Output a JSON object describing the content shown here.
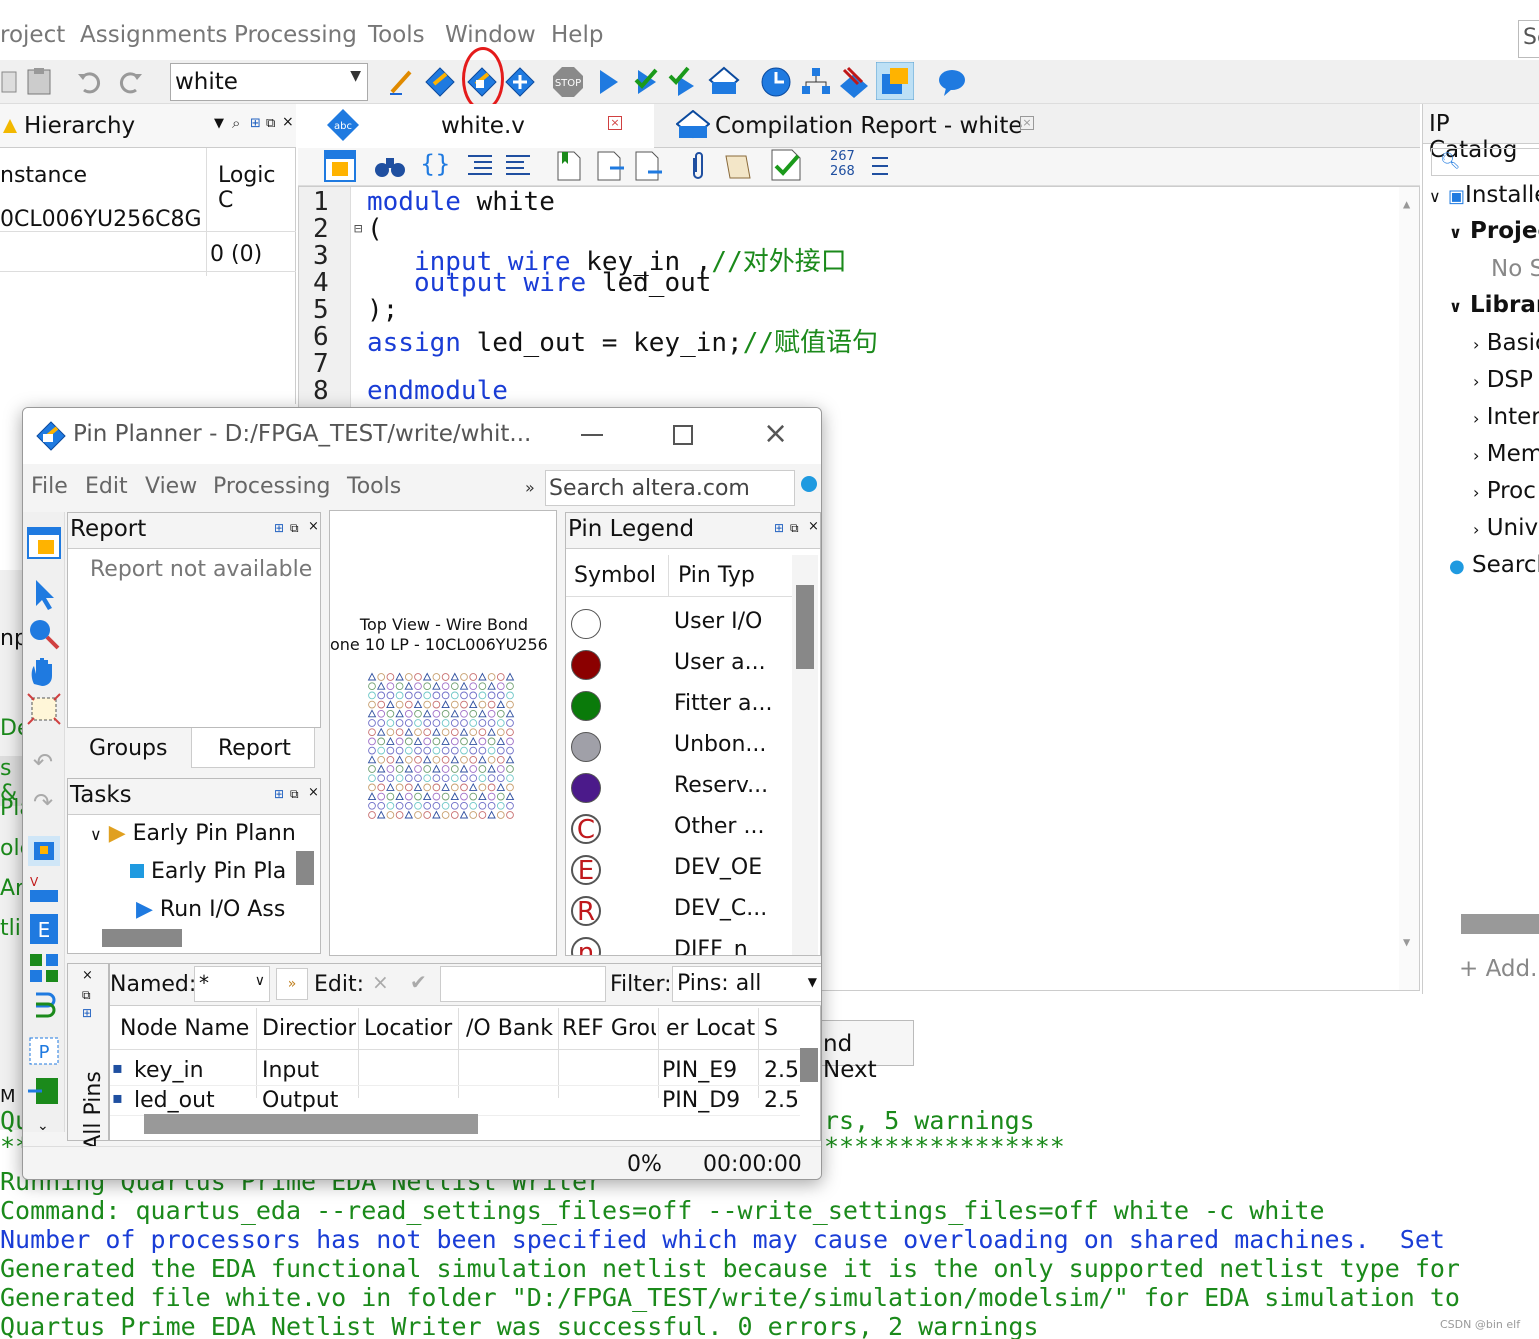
{
  "menubar": {
    "items": [
      "roject",
      "Assignments",
      "Processing",
      "Tools",
      "Window",
      "Help"
    ],
    "search_stub": "Se"
  },
  "toolbar": {
    "revision": "white",
    "icons": [
      "copy-icon",
      "paste-icon",
      "undo-icon",
      "redo-icon",
      "edit-icon",
      "analysis-icon",
      "pin-planner-icon",
      "chip-icon",
      "stop-icon",
      "play-icon",
      "check-icon",
      "check-play-icon",
      "assign-icon",
      "timing-icon",
      "netlist-icon",
      "rtl-icon",
      "chip-planner-icon",
      "help-icon"
    ]
  },
  "hierarchy": {
    "title": "Hierarchy",
    "col_instance": "nstance",
    "col_logic": "Logic C",
    "device": "0CL006YU256C8G",
    "logic_value": "0 (0)"
  },
  "editor": {
    "tab_file": "white.v",
    "tab_report": "Compilation Report - white",
    "linenums_top": "267",
    "linenums_bot": "268",
    "lines": [
      {
        "n": "1",
        "parts": [
          {
            "k": "kw",
            "t": "module"
          },
          {
            "k": "",
            "t": " white"
          }
        ]
      },
      {
        "n": "2",
        "parts": [
          {
            "k": "",
            "t": "("
          }
        ]
      },
      {
        "n": "3",
        "parts": [
          {
            "k": "",
            "t": "   "
          },
          {
            "k": "kw",
            "t": "input"
          },
          {
            "k": "",
            "t": " "
          },
          {
            "k": "kw",
            "t": "wire"
          },
          {
            "k": "",
            "t": " key_in ,"
          },
          {
            "k": "cm",
            "t": "//对外接口"
          }
        ]
      },
      {
        "n": "4",
        "parts": [
          {
            "k": "",
            "t": "   "
          },
          {
            "k": "kw",
            "t": "output"
          },
          {
            "k": "",
            "t": " "
          },
          {
            "k": "kw",
            "t": "wire"
          },
          {
            "k": "",
            "t": " led_out"
          }
        ]
      },
      {
        "n": "5",
        "parts": [
          {
            "k": "",
            "t": ");"
          }
        ]
      },
      {
        "n": "6",
        "parts": [
          {
            "k": "kw",
            "t": "assign"
          },
          {
            "k": "",
            "t": " led_out = key_in;"
          },
          {
            "k": "cm",
            "t": "//赋值语句"
          }
        ]
      },
      {
        "n": "7",
        "parts": []
      },
      {
        "n": "8",
        "parts": [
          {
            "k": "kw",
            "t": "endmodule"
          }
        ]
      }
    ]
  },
  "ip_catalog": {
    "title": "IP Catalog",
    "installed": "Installe",
    "project": "Projec",
    "no_sel": "No S",
    "library": "Librar",
    "items": [
      "Basic",
      "DSP",
      "Inter",
      "Mem",
      "Proc",
      "Univ"
    ],
    "search": "Search",
    "add": "+ Add..."
  },
  "find_next": "nd Next",
  "left_clips": [
    "np",
    "De",
    "s &",
    "Pla",
    "ole",
    "Ar",
    "tli",
    "M"
  ],
  "messages": {
    "m1a": "Qu",
    "m1b": "rs, 5 warnings",
    "m2a": "**",
    "m2b": "****************",
    "m3": "Running Quartus Prime EDA Netlist Writer",
    "m4": "Command: quartus_eda --read_settings_files=off --write_settings_files=off white -c white",
    "m5": "Number of processors has not been specified which may cause overloading on shared machines.  Set",
    "m6": "Generated the EDA functional simulation netlist because it is the only supported netlist type for",
    "m7": "Generated file white.vo in folder \"D:/FPGA_TEST/write/simulation/modelsim/\" for EDA simulation to",
    "m8": "Quartus Prime EDA Netlist Writer was successful. 0 errors, 2 warnings"
  },
  "pin_planner": {
    "title": "Pin Planner - D:/FPGA_TEST/write/whit...",
    "menu": [
      "File",
      "Edit",
      "View",
      "Processing",
      "Tools"
    ],
    "more": "»",
    "search_placeholder": "Search altera.com",
    "report_title": "Report",
    "report_msg": "Report not available",
    "tab_groups": "Groups",
    "tab_report": "Report",
    "tasks_title": "Tasks",
    "tasks": [
      "Early Pin Plann",
      "Early Pin Pla",
      "Run I/O Ass"
    ],
    "package_line1": "Top View - Wire Bond",
    "package_line2": "one 10 LP - 10CL006YU256",
    "legend_title": "Pin Legend",
    "legend_col1": "Symbol",
    "legend_col2": "Pin Typ",
    "legend": [
      {
        "label": "User I/O",
        "color": "#ffffff",
        "letter": ""
      },
      {
        "label": "User a...",
        "color": "#8b0000",
        "letter": ""
      },
      {
        "label": "Fitter a...",
        "color": "#0a7a0a",
        "letter": ""
      },
      {
        "label": "Unbon...",
        "color": "#a0a0a8",
        "letter": ""
      },
      {
        "label": "Reserv...",
        "color": "#4b1a8a",
        "letter": ""
      },
      {
        "label": "Other ...",
        "color": "#ffffff",
        "letter": "C"
      },
      {
        "label": "DEV_OE",
        "color": "#ffffff",
        "letter": "E"
      },
      {
        "label": "DEV_C...",
        "color": "#ffffff",
        "letter": "R"
      },
      {
        "label": "DIFF_n",
        "color": "#ffffff",
        "letter": "n"
      }
    ],
    "named_label": "Named:",
    "named_value": "*",
    "edit_label": "Edit:",
    "filter_label": "Filter:",
    "filter_value": "Pins: all",
    "all_pins": "All Pins",
    "columns": [
      "Node Name",
      "Directior",
      "Locatior",
      "/O Bank",
      "REF Grou",
      "er Locat",
      "S"
    ],
    "rows": [
      {
        "name": "key_in",
        "dir": "Input",
        "loc": "PIN_E9",
        "v": "2.5"
      },
      {
        "name": "led_out",
        "dir": "Output",
        "loc": "PIN_D9",
        "v": "2.5"
      }
    ],
    "progress": "0%",
    "elapsed": "00:00:00"
  },
  "watermark": "CSDN @bin elf"
}
